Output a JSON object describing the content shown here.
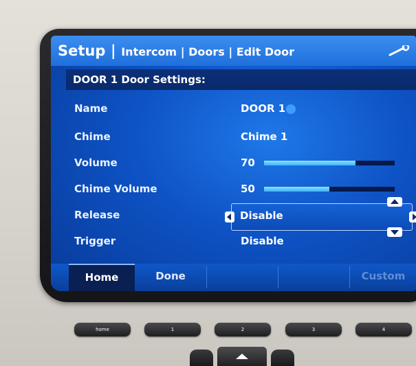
{
  "header": {
    "title": "Setup",
    "breadcrumbs": [
      "Intercom",
      "Doors",
      "Edit Door"
    ],
    "separator": "|"
  },
  "section": {
    "title": "DOOR 1 Door Settings:"
  },
  "settings": [
    {
      "label": "Name",
      "value": "DOOR 1"
    },
    {
      "label": "Chime",
      "value": "Chime 1"
    },
    {
      "label": "Volume",
      "value": "70",
      "level": 0.7
    },
    {
      "label": "Chime Volume",
      "value": "50",
      "level": 0.5
    },
    {
      "label": "Release",
      "value": "Disable"
    },
    {
      "label": "Trigger",
      "value": "Disable"
    }
  ],
  "softkeys": [
    {
      "label": "Home",
      "active": true
    },
    {
      "label": "Done",
      "active": false
    },
    {
      "label": "",
      "active": false
    },
    {
      "label": "",
      "active": false
    },
    {
      "label": "Custom",
      "active": false,
      "dim": true
    }
  ],
  "hardware_keys": [
    "home",
    "1",
    "2",
    "3",
    "4"
  ],
  "colors": {
    "screen_bg": "#0e52c4",
    "title_bar": "#1f6fdc",
    "section_bar": "#0a2a6a",
    "slider_fill": "#3ab2ff",
    "active_softkey": "#0a1f52"
  }
}
